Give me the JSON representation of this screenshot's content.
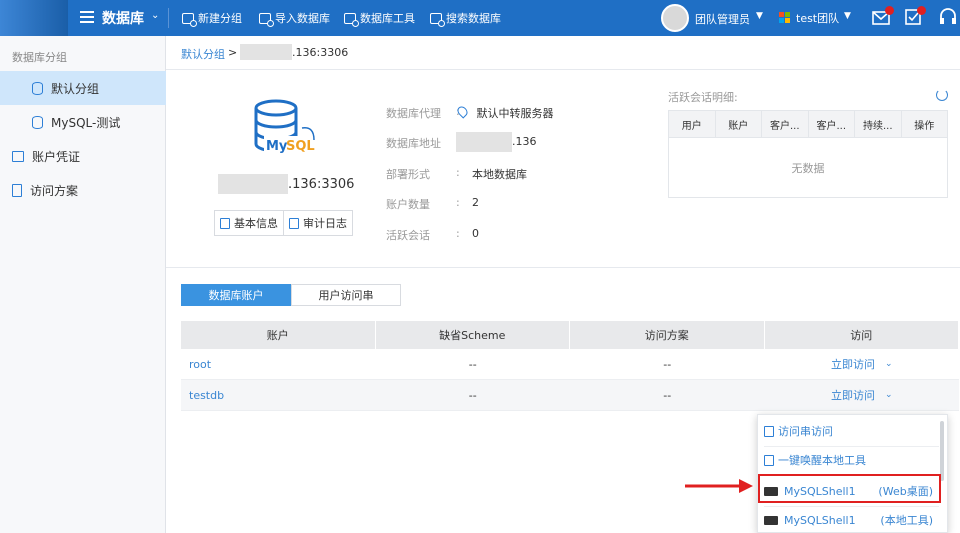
{
  "header": {
    "app_title": "数据库",
    "toolbar": {
      "new_group": "新建分组",
      "import_db": "导入数据库",
      "db_tools": "数据库工具",
      "search_db": "搜索数据库"
    },
    "user_name": "团队管理员",
    "team_name": "test团队"
  },
  "sidebar": {
    "group_label": "数据库分组",
    "items": [
      {
        "label": "默认分组",
        "icon": "database-icon"
      },
      {
        "label": "MySQL-测试",
        "icon": "database-icon"
      },
      {
        "label": "账户凭证",
        "icon": "id-card-icon"
      },
      {
        "label": "访问方案",
        "icon": "document-icon"
      }
    ]
  },
  "breadcrumb": {
    "root": "默认分组",
    "separator": ">",
    "current_suffix": ".136:3306"
  },
  "db_info": {
    "host_suffix": ".136:3306",
    "basic_info_btn": "基本信息",
    "audit_log_btn": "审计日志",
    "fields": [
      {
        "label": "数据库代理",
        "value": "默认中转服务器"
      },
      {
        "label": "数据库地址",
        "value": ".136"
      },
      {
        "label": "部署形式",
        "value": "本地数据库"
      },
      {
        "label": "账户数量",
        "value": "2"
      },
      {
        "label": "活跃会话",
        "value": "0"
      }
    ],
    "colon": ":"
  },
  "sessions": {
    "title": "活跃会话明细:",
    "columns": [
      "用户",
      "账户",
      "客户...",
      "客户...",
      "持续...",
      "操作"
    ],
    "empty": "无数据"
  },
  "tabs": [
    {
      "label": "数据库账户",
      "active": true
    },
    {
      "label": "用户访问串",
      "active": false
    }
  ],
  "accounts": {
    "columns": [
      "账户",
      "缺省Scheme",
      "访问方案",
      "访问"
    ],
    "rows": [
      {
        "account": "root",
        "scheme": "--",
        "plan": "--",
        "access": "立即访问"
      },
      {
        "account": "testdb",
        "scheme": "--",
        "plan": "--",
        "access": "立即访问"
      }
    ]
  },
  "access_dropdown": {
    "items": [
      {
        "label": "访问串访问"
      },
      {
        "label": "一键唤醒本地工具"
      },
      {
        "label": "MySQLShell1",
        "mode": "(Web桌面)"
      },
      {
        "label": "MySQLShell1",
        "mode": "(本地工具)"
      }
    ]
  },
  "colors": {
    "topbar": "#1f6fc5",
    "accent": "#3a86d2",
    "highlight": "#e02020",
    "active_sidebar": "#cfe6fb"
  }
}
